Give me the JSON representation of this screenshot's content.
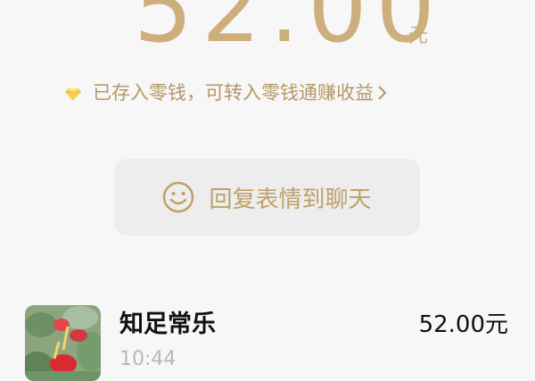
{
  "header": {
    "amount": "52.00",
    "unit": "元"
  },
  "notice": {
    "text": "已存入零钱，可转入零钱通赚收益",
    "icon": "diamond-icon",
    "chevron": "chevron-right-icon"
  },
  "reply": {
    "label": "回复表情到聊天",
    "icon": "smile-icon"
  },
  "record": {
    "name": "知足常乐",
    "time": "10:44",
    "amount": "52.00元"
  },
  "colors": {
    "accent": "#cdae7d",
    "background": "#f7f7f7",
    "button": "#ededed"
  }
}
